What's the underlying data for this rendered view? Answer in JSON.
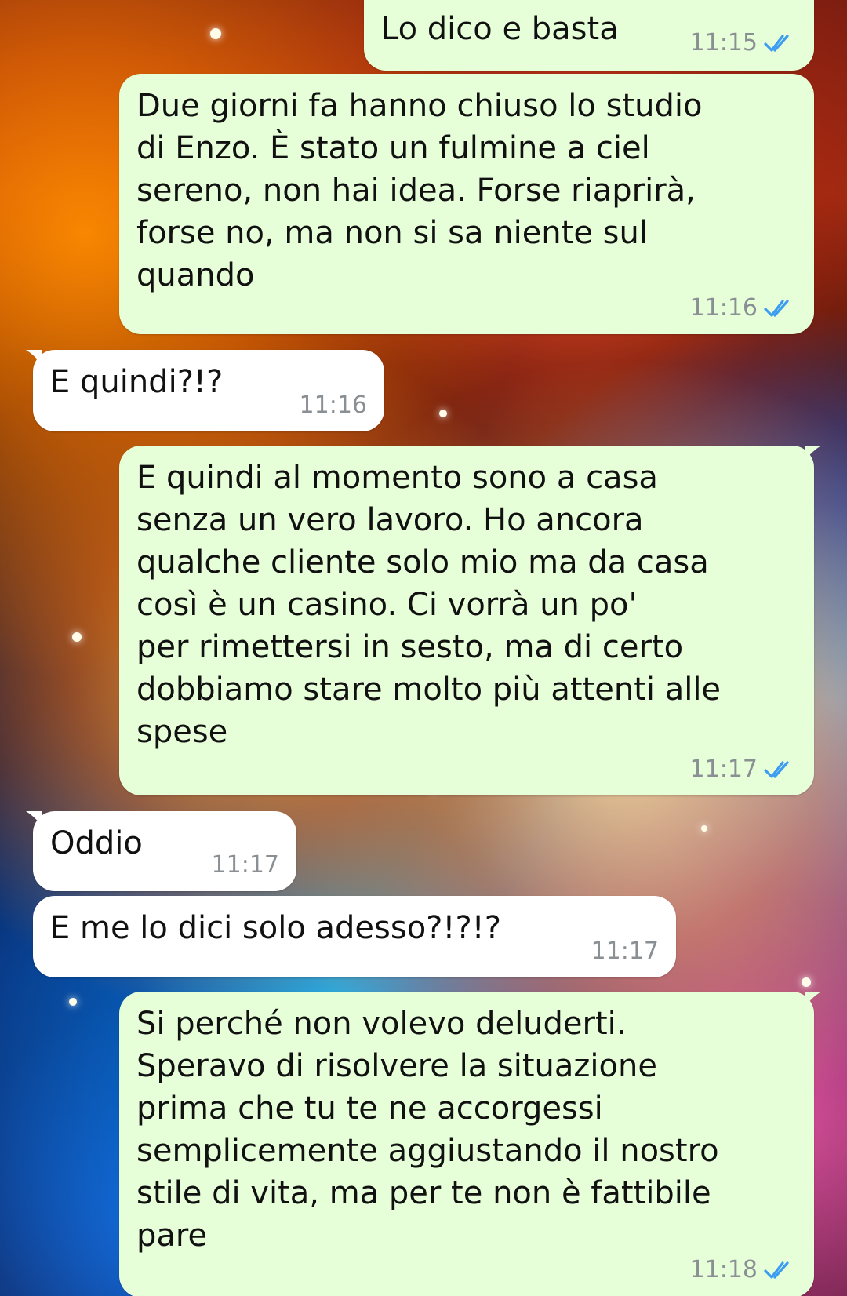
{
  "chat": {
    "messages": [
      {
        "side": "sent",
        "text": "Lo dico e basta",
        "time": "11:15",
        "status": "read"
      },
      {
        "side": "sent",
        "text": "Due giorni fa hanno chiuso lo studio\ndi Enzo. È stato un fulmine a ciel\nsereno, non hai idea. Forse riaprirà,\nforse no, ma non si sa niente sul\nquando",
        "time": "11:16",
        "status": "read"
      },
      {
        "side": "received",
        "text": "E quindi?!?",
        "time": "11:16"
      },
      {
        "side": "sent",
        "text": "E quindi al momento sono a casa\nsenza un vero lavoro. Ho ancora\nqualche cliente solo mio ma da casa\ncosì è un casino. Ci vorrà un po'\nper rimettersi in sesto, ma di certo\ndobbiamo stare molto più attenti alle\nspese",
        "time": "11:17",
        "status": "read"
      },
      {
        "side": "received",
        "text": "Oddio",
        "time": "11:17"
      },
      {
        "side": "received",
        "text": "E me lo dici solo adesso?!?!?",
        "time": "11:17"
      },
      {
        "side": "sent",
        "text": "Si perché non volevo deluderti.\nSperavo di risolvere la situazione\nprima che tu te ne accorgessi\nsemplicemente aggiustando il nostro\nstile di vita, ma per te non è fattibile\npare",
        "time": "11:18",
        "status": "read"
      }
    ]
  },
  "colors": {
    "sent_bubble": "#e7ffd9",
    "received_bubble": "#ffffff",
    "timestamp": "#8a8f93",
    "read_check": "#3b9cf1"
  },
  "icons": {
    "read_receipt": "double-check-icon"
  }
}
